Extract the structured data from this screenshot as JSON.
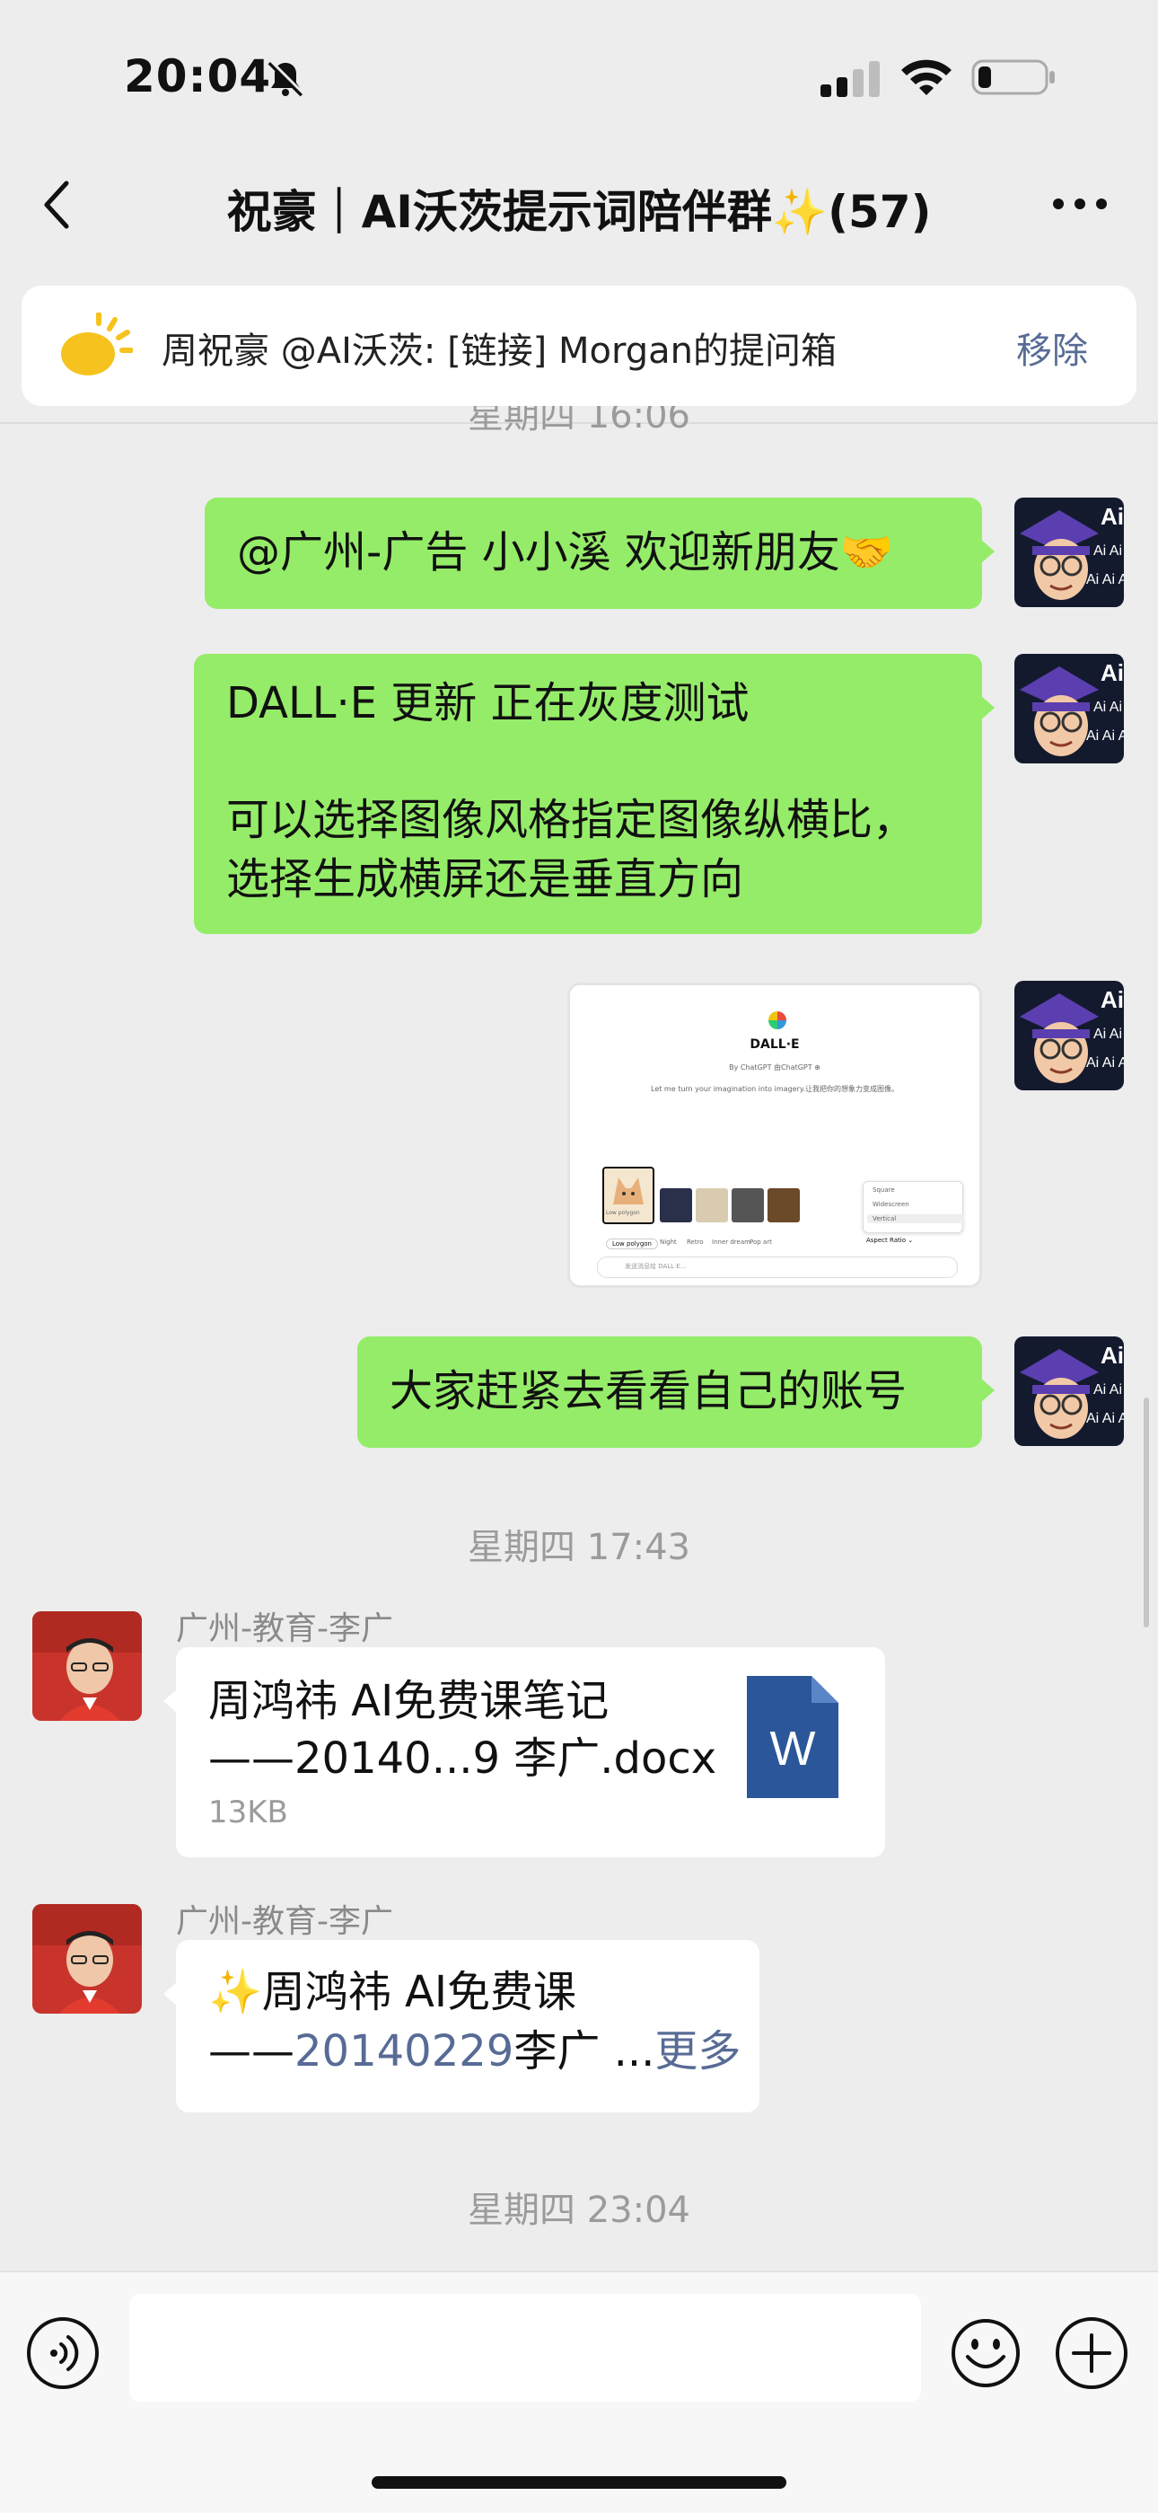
{
  "status_bar": {
    "time": "20:04"
  },
  "nav": {
    "title": "祝豪｜AI沃茨提示词陪伴群✨(57)"
  },
  "notice": {
    "text": "周祝豪 @AI沃茨: [链接] Morgan的提问箱",
    "remove_label": "移除"
  },
  "separators": {
    "top_partial": "星期四 16:06",
    "sep1": "星期四 17:43",
    "sep2": "星期四 23:04"
  },
  "messages": [
    {
      "from": "me",
      "text": "@广州-广告 小小溪 欢迎新朋友🤝"
    },
    {
      "from": "me",
      "line1": "DALL·E 更新 正在灰度测试",
      "line2": "可以选择图像风格指定图像纵横比，",
      "line3": "选择生成横屏还是垂直方向"
    },
    {
      "from": "me",
      "type": "image"
    },
    {
      "from": "me",
      "text": "大家赶紧去看看自己的账号"
    },
    {
      "from": "other",
      "sender": "广州-教育-李广",
      "file_name_line1": "周鸿祎 AI免费课笔记",
      "file_name_line2": "——20140...9 李广.docx",
      "file_size": "13KB",
      "file_icon_letter": "W"
    },
    {
      "from": "other",
      "sender": "广州-教育-李广",
      "line1": "✨周鸿祎 AI免费课",
      "line2_prefix": "——",
      "line2_link": "20140229",
      "line2_rest": "李广 ...",
      "more_label": "更多"
    }
  ],
  "dalle_screenshot": {
    "title": "DALL·E",
    "byline": "By ChatGPT 由ChatGPT ⊕",
    "tagline": "Let me turn your imagination into imagery.让我把你的想象力变成图像。",
    "styles": [
      "Low polygon",
      "Night",
      "Retro",
      "Inner dream",
      "Pop art"
    ],
    "selected_style": "Low polygon",
    "aspect_options": [
      "Square",
      "Widescreen",
      "Vertical"
    ],
    "aspect_label": "Aspect Ratio ⌄",
    "input_placeholder": "发送消息给 DALL·E..."
  },
  "colors": {
    "bubble_me": "#95ec69",
    "link": "#576b95",
    "word_icon": "#2b579a"
  },
  "icons": [
    "bell-off-icon",
    "signal-icon",
    "wifi-icon",
    "battery-icon",
    "back-icon",
    "more-icon",
    "sun-icon",
    "word-file-icon",
    "voice-icon",
    "emoji-icon",
    "plus-icon"
  ]
}
